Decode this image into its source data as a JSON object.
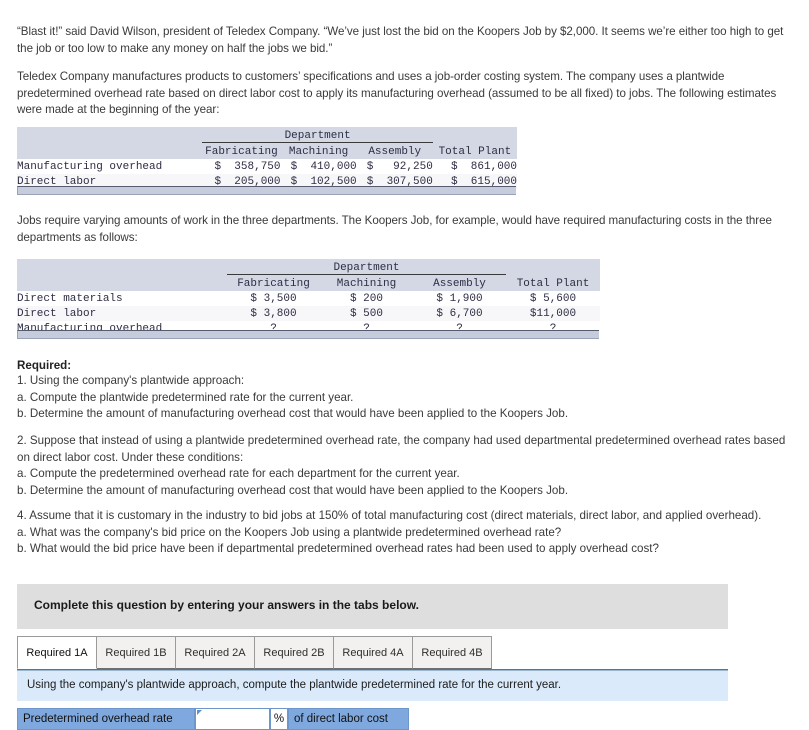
{
  "narrative": {
    "quote": "“Blast it!” said David Wilson, president of Teledex Company. “We’ve just lost the bid on the Koopers Job by $2,000. It seems we’re either too high to get the job or too low to make any money on half the jobs we bid.”",
    "intro": "Teledex Company manufactures products to customers’ specifications and uses a job-order costing system. The company uses a plantwide predetermined overhead rate based on direct labor cost to apply its manufacturing overhead (assumed to be all fixed) to jobs. The following estimates were made at the beginning of the year:",
    "jobs": "Jobs require varying amounts of work in the three departments. The Koopers Job, for example, would have required manufacturing costs in the three departments as follows:"
  },
  "table1": {
    "group_header": "Department",
    "columns": [
      "Fabricating",
      "Machining",
      "Assembly",
      "Total Plant"
    ],
    "rows": [
      {
        "label": "Manufacturing overhead",
        "cells": [
          "$  358,750",
          "$  410,000",
          "$   92,250",
          "$  861,000"
        ]
      },
      {
        "label": "Direct labor",
        "cells": [
          "$  205,000",
          "$  102,500",
          "$  307,500",
          "$  615,000"
        ]
      }
    ]
  },
  "table2": {
    "group_header": "Department",
    "columns": [
      "Fabricating",
      "Machining",
      "Assembly",
      "Total Plant"
    ],
    "rows": [
      {
        "label": "Direct materials",
        "cells": [
          "$ 3,500",
          "$ 200",
          "$ 1,900",
          "$ 5,600"
        ]
      },
      {
        "label": "Direct labor",
        "cells": [
          "$ 3,800",
          "$ 500",
          "$ 6,700",
          "$11,000"
        ]
      },
      {
        "label": "Manufacturing overhead",
        "cells": [
          "?",
          "?",
          "?",
          "?"
        ]
      }
    ]
  },
  "required": {
    "heading": "Required:",
    "group1": [
      "1. Using the company's plantwide approach:",
      "a. Compute the plantwide predetermined rate for the current year.",
      "b. Determine the amount of manufacturing overhead cost that would have been applied to the Koopers Job."
    ],
    "group2": [
      "2. Suppose that instead of using a plantwide predetermined overhead rate, the company had used departmental predetermined overhead rates based on direct labor cost. Under these conditions:",
      "a. Compute the predetermined overhead rate for each department for the current year.",
      "b. Determine the amount of manufacturing overhead cost that would have been applied to the Koopers Job."
    ],
    "group4": [
      "4. Assume that it is customary in the industry to bid jobs at 150% of total manufacturing cost (direct materials, direct labor, and applied overhead).",
      "a. What was the company's bid price on the Koopers Job using a plantwide predetermined overhead rate?",
      "b. What would the bid price have been if departmental predetermined overhead rates had been used to apply overhead cost?"
    ]
  },
  "answer_widget": {
    "complete_message": "Complete this question by entering your answers in the tabs below.",
    "tabs": [
      {
        "label": "Required 1A",
        "active": true
      },
      {
        "label": "Required 1B",
        "active": false
      },
      {
        "label": "Required 2A",
        "active": false
      },
      {
        "label": "Required 2B",
        "active": false
      },
      {
        "label": "Required 4A",
        "active": false
      },
      {
        "label": "Required 4B",
        "active": false
      }
    ],
    "instruction": "Using the company's plantwide approach, compute the plantwide predetermined rate for the current year.",
    "answer_row": {
      "label": "Predetermined overhead rate",
      "input_value": "",
      "percent_symbol": "%",
      "suffix": "of direct labor cost"
    }
  },
  "colors": {
    "table_header_band": "#d3d8e4",
    "table_footer_band": "#c6ccdb",
    "complete_box": "#dededf",
    "instruction_bar": "#daeafa",
    "answer_cell": "#7fa9de",
    "active_tab": "#ffffff",
    "inactive_tab": "#f2f1ef"
  }
}
